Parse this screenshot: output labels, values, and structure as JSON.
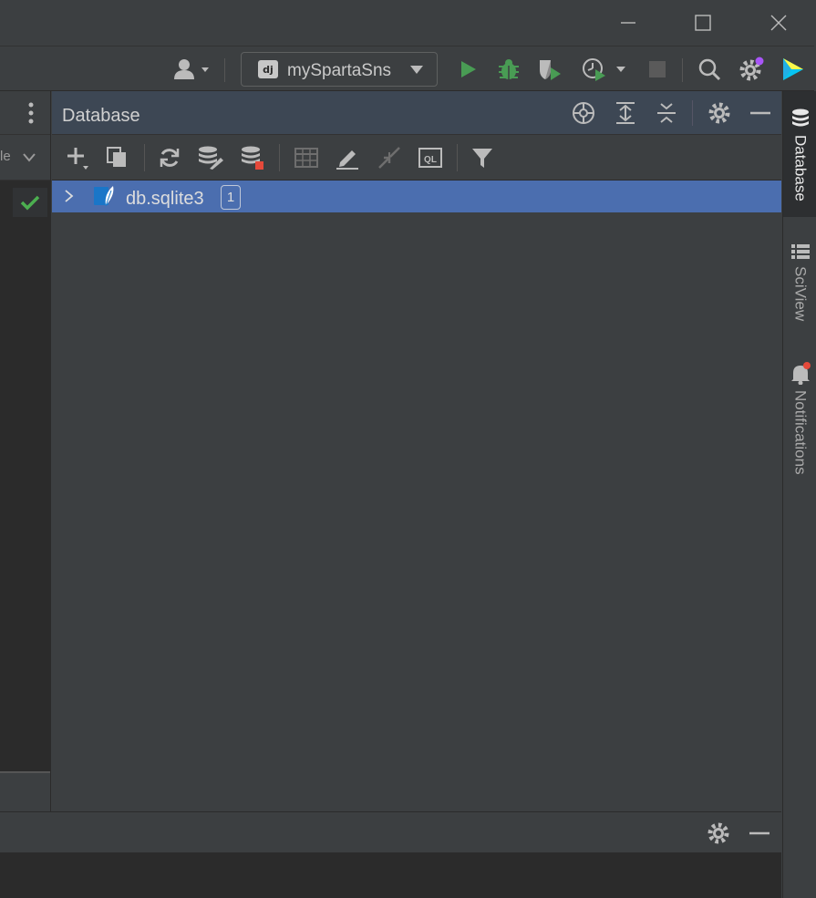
{
  "window": {
    "minimize_icon": "minimize-icon",
    "maximize_icon": "maximize-icon",
    "close_icon": "close-icon"
  },
  "toolbar": {
    "run_config": {
      "badge": "dj",
      "label": "mySpartaSns"
    },
    "icons": [
      "user-icon",
      "run-icon",
      "debug-icon",
      "coverage-icon",
      "profile-icon",
      "stop-icon",
      "search-icon",
      "settings-icon",
      "logo-icon"
    ],
    "colors": {
      "run": "#499c54",
      "debug": "#499c54",
      "stop": "#5a5a5a"
    }
  },
  "left_panel": {
    "partial_label": "le",
    "status": "check"
  },
  "database_panel": {
    "title": "Database",
    "tree": [
      {
        "name": "db.sqlite3",
        "badge": "1"
      }
    ]
  },
  "right_stripe": {
    "tabs": [
      {
        "label": "Database",
        "active": true
      },
      {
        "label": "SciView",
        "active": false
      },
      {
        "label": "Notifications",
        "active": false
      }
    ]
  },
  "colors": {
    "selection": "#4b6eaf",
    "panel_header": "#3d4754",
    "background": "#3c3f41",
    "editor": "#2b2b2b"
  }
}
